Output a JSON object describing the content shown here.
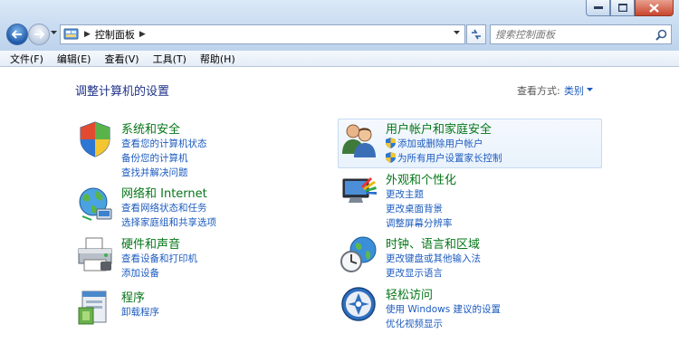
{
  "address": {
    "path": "控制面板",
    "search_placeholder": "搜索控制面板"
  },
  "menu": [
    "文件(F)",
    "编辑(E)",
    "查看(V)",
    "工具(T)",
    "帮助(H)"
  ],
  "main": {
    "title": "调整计算机的设置",
    "view_by_label": "查看方式:",
    "view_by_value": "类别"
  },
  "categories": [
    {
      "title": "系统和安全",
      "icon": "shield-flag-icon",
      "links": [
        "查看您的计算机状态",
        "备份您的计算机",
        "查找并解决问题"
      ]
    },
    {
      "title": "网络和 Internet",
      "icon": "network-globe-icon",
      "links": [
        "查看网络状态和任务",
        "选择家庭组和共享选项"
      ]
    },
    {
      "title": "硬件和声音",
      "icon": "printer-icon",
      "links": [
        "查看设备和打印机",
        "添加设备"
      ]
    },
    {
      "title": "程序",
      "icon": "programs-icon",
      "links": [
        "卸载程序"
      ]
    },
    {
      "title": "用户帐户和家庭安全",
      "icon": "users-icon",
      "links": [
        "添加或删除用户帐户",
        "为所有用户设置家长控制"
      ]
    },
    {
      "title": "外观和个性化",
      "icon": "display-palette-icon",
      "links": [
        "更改主题",
        "更改桌面背景",
        "调整屏幕分辨率"
      ]
    },
    {
      "title": "时钟、语言和区域",
      "icon": "clock-globe-icon",
      "links": [
        "更改键盘或其他输入法",
        "更改显示语言"
      ]
    },
    {
      "title": "轻松访问",
      "icon": "ease-of-access-icon",
      "links": [
        "使用 Windows 建议的设置",
        "优化视频显示"
      ]
    }
  ]
}
